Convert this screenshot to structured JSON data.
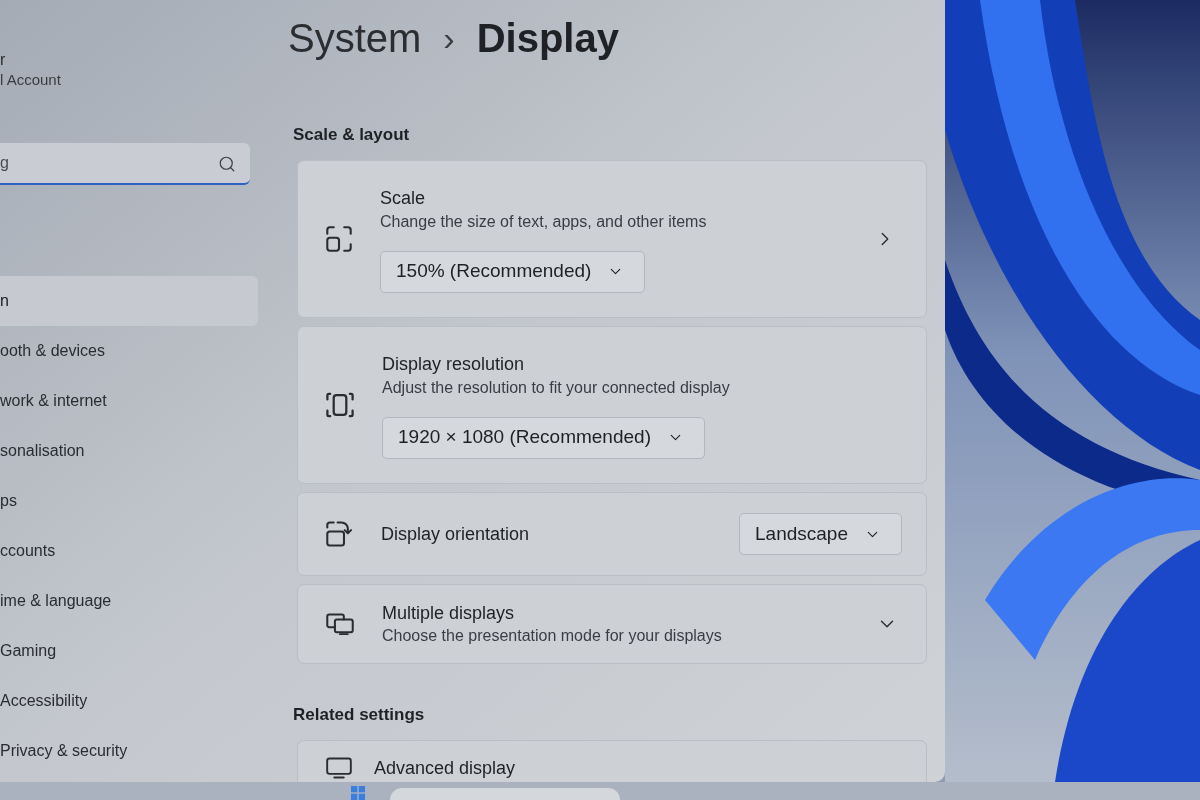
{
  "account": {
    "name": "r",
    "type": "l Account"
  },
  "search": {
    "placeholder": "g"
  },
  "nav": [
    {
      "label": "n",
      "selected": true
    },
    {
      "label": "ooth & devices",
      "selected": false
    },
    {
      "label": "work & internet",
      "selected": false
    },
    {
      "label": "sonalisation",
      "selected": false
    },
    {
      "label": "ps",
      "selected": false
    },
    {
      "label": "ccounts",
      "selected": false
    },
    {
      "label": "ime & language",
      "selected": false
    },
    {
      "label": "Gaming",
      "selected": false
    },
    {
      "label": "Accessibility",
      "selected": false
    },
    {
      "label": "Privacy & security",
      "selected": false
    }
  ],
  "breadcrumb": {
    "parent": "System",
    "separator": "›",
    "current": "Display"
  },
  "sections": [
    {
      "heading": "Scale & layout",
      "cards": [
        {
          "kind": "stacked",
          "title": "Scale",
          "subtitle": "Change the size of text, apps, and other items",
          "value": "150% (Recommended)",
          "navigates": true
        },
        {
          "kind": "stacked",
          "title": "Display resolution",
          "subtitle": "Adjust the resolution to fit your connected display",
          "value": "1920 × 1080 (Recommended)",
          "navigates": false
        },
        {
          "kind": "inline",
          "title": "Display orientation",
          "value": "Landscape"
        },
        {
          "kind": "expander",
          "title": "Multiple displays",
          "subtitle": "Choose the presentation mode for your displays",
          "expanded": false
        }
      ]
    },
    {
      "heading": "Related settings",
      "cards": [
        {
          "kind": "link",
          "title": "Advanced display"
        }
      ]
    }
  ]
}
